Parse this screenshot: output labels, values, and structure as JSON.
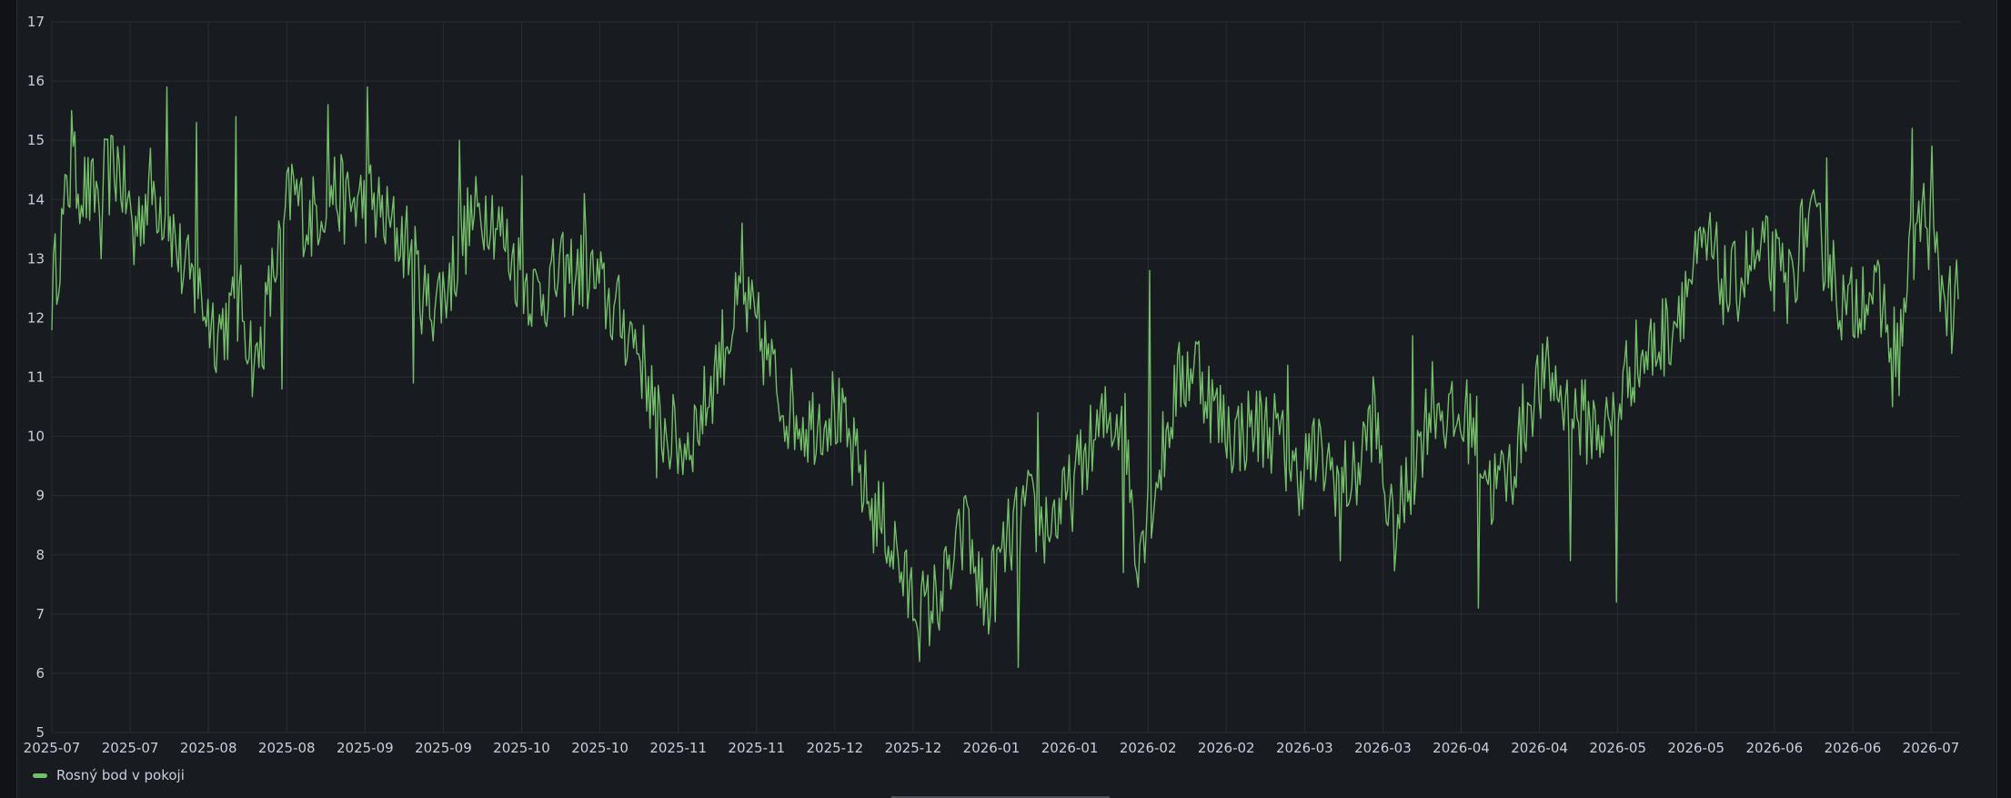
{
  "chart_data": {
    "type": "line",
    "ylim": [
      5,
      17
    ],
    "yticks": [
      5,
      6,
      7,
      8,
      9,
      10,
      11,
      12,
      13,
      14,
      15,
      16,
      17
    ],
    "xticks": [
      "2025-07",
      "2025-07",
      "2025-08",
      "2025-08",
      "2025-09",
      "2025-09",
      "2025-10",
      "2025-10",
      "2025-11",
      "2025-11",
      "2025-12",
      "2025-12",
      "2026-01",
      "2026-01",
      "2026-02",
      "2026-02",
      "2026-03",
      "2026-03",
      "2026-04",
      "2026-04",
      "2026-05",
      "2026-05",
      "2026-06",
      "2026-06",
      "2026-07"
    ],
    "grid": true,
    "legend_position": "bottom-left",
    "series": [
      {
        "name": "Rosný bod v pokoji",
        "color": "#73bf69",
        "x_start": "2025-07-01",
        "x_end": "2026-07-04",
        "keypoints": [
          [
            0,
            12.4
          ],
          [
            6,
            14.5
          ],
          [
            12,
            14.0
          ],
          [
            20,
            14.6
          ],
          [
            25,
            13.5
          ],
          [
            30,
            14.2
          ],
          [
            35,
            13.8
          ],
          [
            40,
            12.8
          ],
          [
            45,
            12.4
          ],
          [
            50,
            11.8
          ],
          [
            58,
            12.2
          ],
          [
            62,
            11.1
          ],
          [
            68,
            12.9
          ],
          [
            73,
            14.2
          ],
          [
            78,
            13.6
          ],
          [
            85,
            14.2
          ],
          [
            90,
            13.9
          ],
          [
            97,
            14.0
          ],
          [
            103,
            13.5
          ],
          [
            108,
            13.3
          ],
          [
            114,
            12.2
          ],
          [
            120,
            12.5
          ],
          [
            127,
            13.6
          ],
          [
            133,
            13.9
          ],
          [
            140,
            13.0
          ],
          [
            147,
            12.4
          ],
          [
            155,
            12.7
          ],
          [
            163,
            12.8
          ],
          [
            170,
            12.2
          ],
          [
            178,
            11.6
          ],
          [
            185,
            10.2
          ],
          [
            192,
            9.8
          ],
          [
            198,
            10.4
          ],
          [
            204,
            11.5
          ],
          [
            210,
            12.3
          ],
          [
            216,
            11.6
          ],
          [
            222,
            10.6
          ],
          [
            230,
            10.2
          ],
          [
            238,
            10.5
          ],
          [
            244,
            9.6
          ],
          [
            250,
            8.7
          ],
          [
            255,
            8.4
          ],
          [
            260,
            7.4
          ],
          [
            266,
            7.0
          ],
          [
            272,
            7.5
          ],
          [
            278,
            8.4
          ],
          [
            284,
            7.1
          ],
          [
            290,
            8.1
          ],
          [
            296,
            8.8
          ],
          [
            302,
            8.5
          ],
          [
            308,
            8.8
          ],
          [
            314,
            9.6
          ],
          [
            320,
            10.2
          ],
          [
            326,
            10.4
          ],
          [
            330,
            8.1
          ],
          [
            336,
            9.2
          ],
          [
            342,
            10.8
          ],
          [
            348,
            11.3
          ],
          [
            354,
            10.4
          ],
          [
            360,
            10.0
          ],
          [
            366,
            10.2
          ],
          [
            372,
            10.1
          ],
          [
            378,
            9.3
          ],
          [
            384,
            9.7
          ],
          [
            390,
            9.4
          ],
          [
            396,
            9.2
          ],
          [
            402,
            10.4
          ],
          [
            408,
            8.3
          ],
          [
            414,
            9.4
          ],
          [
            420,
            10.7
          ],
          [
            426,
            10.2
          ],
          [
            432,
            10.3
          ],
          [
            438,
            9.1
          ],
          [
            444,
            9.4
          ],
          [
            450,
            10.7
          ],
          [
            456,
            11.0
          ],
          [
            462,
            10.4
          ],
          [
            468,
            10.2
          ],
          [
            474,
            10.1
          ],
          [
            480,
            11.2
          ],
          [
            486,
            11.4
          ],
          [
            492,
            11.8
          ],
          [
            498,
            12.6
          ],
          [
            504,
            13.2
          ],
          [
            510,
            12.4
          ],
          [
            516,
            12.9
          ],
          [
            522,
            13.0
          ],
          [
            528,
            12.5
          ],
          [
            534,
            13.6
          ],
          [
            540,
            13.1
          ],
          [
            546,
            12.0
          ],
          [
            552,
            12.6
          ],
          [
            558,
            12.0
          ],
          [
            562,
            11.4
          ],
          [
            566,
            13.2
          ],
          [
            570,
            13.8
          ],
          [
            575,
            12.5
          ],
          [
            580,
            12.2
          ]
        ],
        "spikes": [
          [
            6,
            15.5
          ],
          [
            15,
            13.0
          ],
          [
            25,
            12.9
          ],
          [
            35,
            15.9
          ],
          [
            44,
            15.3
          ],
          [
            56,
            15.4
          ],
          [
            70,
            10.8
          ],
          [
            84,
            15.6
          ],
          [
            96,
            15.9
          ],
          [
            110,
            10.9
          ],
          [
            124,
            15.0
          ],
          [
            143,
            14.4
          ],
          [
            162,
            14.1
          ],
          [
            184,
            9.3
          ],
          [
            210,
            13.6
          ],
          [
            255,
            7.8
          ],
          [
            264,
            6.2
          ],
          [
            278,
            9.0
          ],
          [
            294,
            6.1
          ],
          [
            300,
            10.4
          ],
          [
            315,
            9.1
          ],
          [
            326,
            7.7
          ],
          [
            334,
            12.8
          ],
          [
            356,
            9.9
          ],
          [
            376,
            11.2
          ],
          [
            392,
            7.9
          ],
          [
            414,
            11.7
          ],
          [
            434,
            7.1
          ],
          [
            462,
            7.9
          ],
          [
            476,
            7.2
          ],
          [
            496,
            12.6
          ],
          [
            522,
            13.7
          ],
          [
            540,
            14.7
          ],
          [
            548,
            11.7
          ],
          [
            560,
            10.5
          ],
          [
            566,
            15.2
          ],
          [
            572,
            14.9
          ],
          [
            578,
            11.4
          ]
        ],
        "note_amplitude": 0.75
      }
    ]
  },
  "legend": {
    "label": "Rosný bod v pokoji"
  }
}
